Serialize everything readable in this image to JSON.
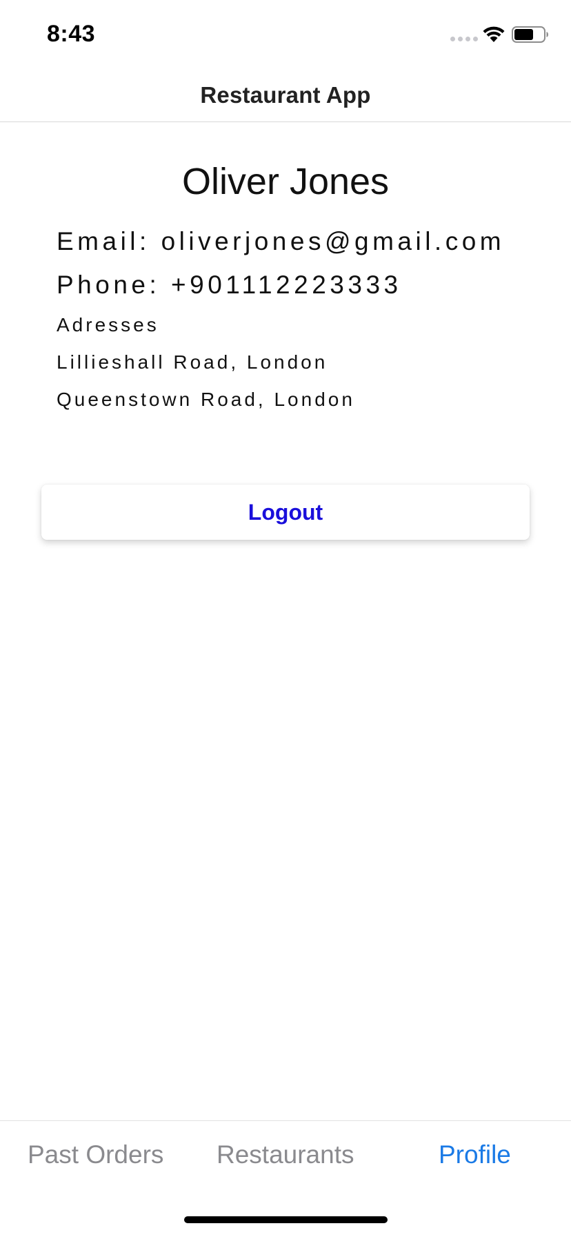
{
  "status_bar": {
    "time": "8:43"
  },
  "header": {
    "title": "Restaurant App"
  },
  "profile": {
    "name": "Oliver Jones",
    "email_line": "Email: oliverjones@gmail.com",
    "phone_line": "Phone: +901112223333",
    "addresses_heading": "Adresses",
    "addresses": [
      "Lillieshall Road, London",
      "Queenstown Road, London"
    ],
    "logout_label": "Logout"
  },
  "tab_bar": {
    "tabs": [
      {
        "label": "Past Orders",
        "active": false
      },
      {
        "label": "Restaurants",
        "active": false
      },
      {
        "label": "Profile",
        "active": true
      }
    ],
    "active_color": "#1a7ae6",
    "inactive_color": "#8a8a8e"
  },
  "colors": {
    "logout_text": "#1a0fdb"
  }
}
